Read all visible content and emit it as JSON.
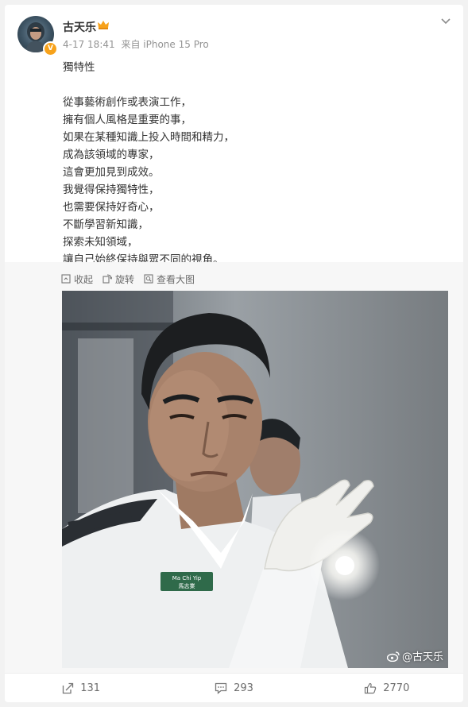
{
  "post": {
    "username": "古天乐",
    "verified_badge": "V",
    "time": "4-17 18:41",
    "source": "来自 iPhone 15 Pro",
    "lines": [
      "獨特性",
      "",
      "從事藝術創作或表演工作，",
      "擁有個人風格是重要的事，",
      "如果在某種知識上投入時間和精力，",
      "成為該領域的專家，",
      "這會更加見到成效。",
      "我覺得保持獨特性，",
      "也需要保持好奇心，",
      "不斷學習新知識，",
      "探索未知領域，",
      "讓自己始終保持與眾不同的視角。"
    ]
  },
  "media_tools": {
    "collapse": "收起",
    "rotate": "旋转",
    "view_large": "查看大图"
  },
  "photo": {
    "watermark": "@古天乐",
    "badge_text_en": "Ma Chi Yip",
    "badge_text_zh": "馬志業"
  },
  "actions": {
    "repost": "131",
    "comment": "293",
    "like": "2770"
  },
  "colors": {
    "accent": "#f7a21b",
    "text": "#333333",
    "meta": "#939393",
    "background": "#f2f2f2"
  },
  "icons": [
    "chevron-down-icon",
    "crown-icon",
    "collapse-icon",
    "rotate-icon",
    "view-large-icon",
    "weibo-logo-icon",
    "repost-icon",
    "comment-icon",
    "like-icon"
  ]
}
